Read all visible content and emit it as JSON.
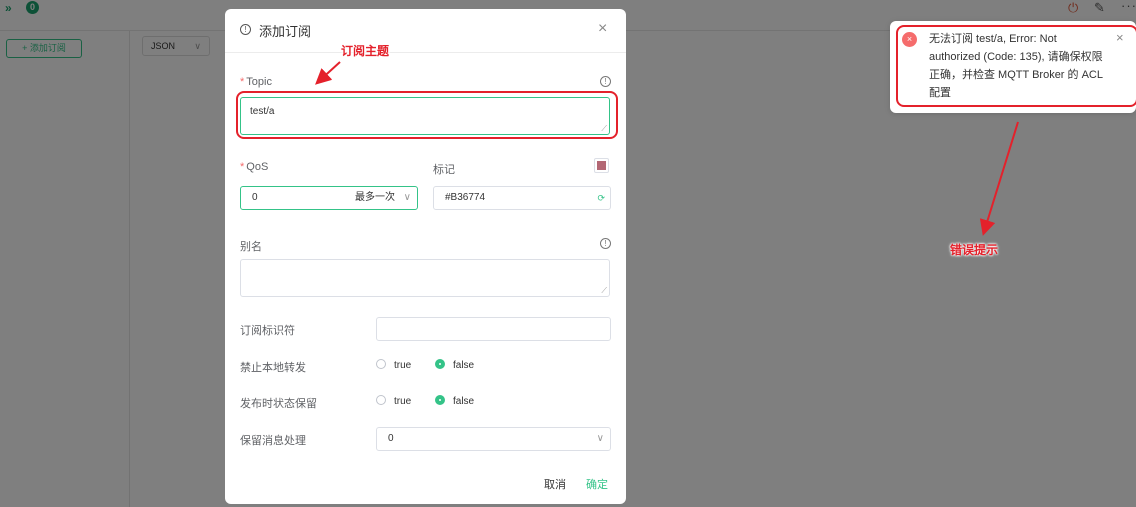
{
  "topbar": {
    "connected_count": "0",
    "chevron_glyph": "»",
    "power_glyph": "⏻",
    "edit_glyph": "✎",
    "more_glyph": "···"
  },
  "sidebar": {
    "add_subscription_label": "+ 添加订阅"
  },
  "payload": {
    "format_value": "JSON"
  },
  "dialog": {
    "title": "添加订阅",
    "topic_label": "Topic",
    "topic_value": "test/a",
    "qos_label": "QoS",
    "qos_value": "0",
    "qos_desc": "最多一次",
    "color_label": "标记",
    "color_value": "#B36774",
    "alias_label": "别名",
    "alias_value": "",
    "sub_id_label": "订阅标识符",
    "sub_id_value": "",
    "no_local_label": "禁止本地转发",
    "retain_as_published_label": "发布时状态保留",
    "retain_handling_label": "保留消息处理",
    "retain_handling_value": "0",
    "true_label": "true",
    "false_label": "false",
    "no_local_selected": "false",
    "retain_as_published_selected": "false",
    "cancel_label": "取消",
    "confirm_label": "确定"
  },
  "notification": {
    "type": "error",
    "message": "无法订阅 test/a, Error: Not authorized (Code: 135), 请确保权限正确，并检查 MQTT Broker 的 ACL 配置"
  },
  "annotations": {
    "topic_callout": "订阅主题",
    "error_callout": "错误提示"
  },
  "colors": {
    "accent": "#34c388",
    "marker": "#B36774",
    "error": "#f56c6c",
    "annotation": "#e4212b"
  }
}
